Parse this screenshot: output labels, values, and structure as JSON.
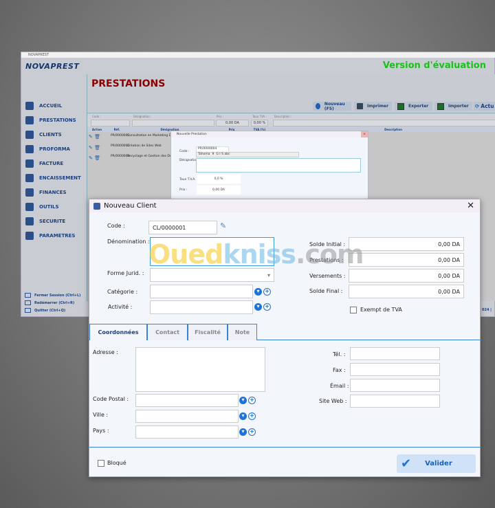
{
  "app": {
    "window_title": "NOVAPREST",
    "logo": "NOVAPREST",
    "eval_banner": "Version d'évaluation",
    "page_title": "PRESTATIONS",
    "sidebar": [
      {
        "label": "ACCUEIL",
        "icon": "home-icon"
      },
      {
        "label": "PRESTATIONS",
        "icon": "service-icon"
      },
      {
        "label": "CLIENTS",
        "icon": "user-icon"
      },
      {
        "label": "PROFORMA",
        "icon": "document-icon"
      },
      {
        "label": "FACTURE",
        "icon": "invoice-icon"
      },
      {
        "label": "ENCAISSEMENT",
        "icon": "cash-icon"
      },
      {
        "label": "FINANCES",
        "icon": "finance-icon"
      },
      {
        "label": "OUTILS",
        "icon": "tools-icon"
      },
      {
        "label": "SECURITE",
        "icon": "key-icon"
      },
      {
        "label": "PARAMETRES",
        "icon": "gear-icon"
      }
    ],
    "footer": [
      {
        "label": "Fermer Session  (Ctrl+L)"
      },
      {
        "label": "Redémarrer  (Ctrl+R)"
      },
      {
        "label": "Quitter  (Ctrl+Q)"
      }
    ],
    "toolbar": {
      "new": "Nouveau (F5)",
      "print": "Imprimer",
      "export": "Exporter",
      "import": "Importer",
      "refresh": "Actu"
    },
    "filter": {
      "code": "Code :",
      "designation": "Désignation :",
      "prix": "Prix :",
      "prix_value": "0,00 DA",
      "taux": "Taux TVA :",
      "taux_value": "0,00 %",
      "description": "Description :"
    },
    "grid": {
      "headers": [
        "Action",
        "Réf.",
        "Désignation",
        "Prix",
        "TVA (%)",
        "Description"
      ],
      "rows": [
        {
          "ref": "PR/0000001",
          "designation": "Consultation en Marketing Digital"
        },
        {
          "ref": "PR/0000002",
          "designation": "Création de Sites Web"
        },
        {
          "ref": "PR/0000003",
          "designation": "Recyclage et Gestion des Déchets"
        }
      ]
    },
    "status_fragment": "024 |"
  },
  "prestation_dialog": {
    "title": "Nouvelle Prestation",
    "code_label": "Code :",
    "code_value": "PR/0000004",
    "font": "Tahoma",
    "size": "9",
    "designation_label": "Désignation :",
    "taux_label": "Taux T.V.A. :",
    "taux_value": "0,0 %",
    "prix_label": "Prix :",
    "prix_value": "0,00 DA"
  },
  "client_dialog": {
    "title": "Nouveau Client",
    "code_label": "Code :",
    "code_value": "CL/0000001",
    "denomination_label": "Dénomination :",
    "denomination_value": "",
    "forme_label": "Forme Jurid. :",
    "categorie_label": "Catégorie :",
    "activite_label": "Activité :",
    "solde_initial_label": "Solde Initial :",
    "solde_initial": "0,00 DA",
    "prestations_label": "Prestations :",
    "prestations": "0,00 DA",
    "versements_label": "Versements :",
    "versements": "0,00 DA",
    "solde_final_label": "Solde Final :",
    "solde_final": "0,00 DA",
    "exempt_label": "Exempt de TVA",
    "exempt_checked": false,
    "tabs": [
      "Coordonnées",
      "Contact",
      "Fiscalité",
      "Note"
    ],
    "adresse_label": "Adresse :",
    "code_postal_label": "Code Postal :",
    "ville_label": "Ville :",
    "pays_label": "Pays :",
    "tel_label": "Tél. :",
    "fax_label": "Fax :",
    "email_label": "Émail :",
    "site_label": "Site Web :",
    "bloque_label": "Bloqué",
    "bloque_checked": false,
    "validate": "Valider"
  },
  "watermark": {
    "part1": "Oued",
    "part2": "kniss",
    "part3": ".com"
  },
  "colors": {
    "accent": "#1e73d6",
    "title_red": "#8b0000",
    "eval_green": "#18c218",
    "nav": "#1c3f7c"
  }
}
